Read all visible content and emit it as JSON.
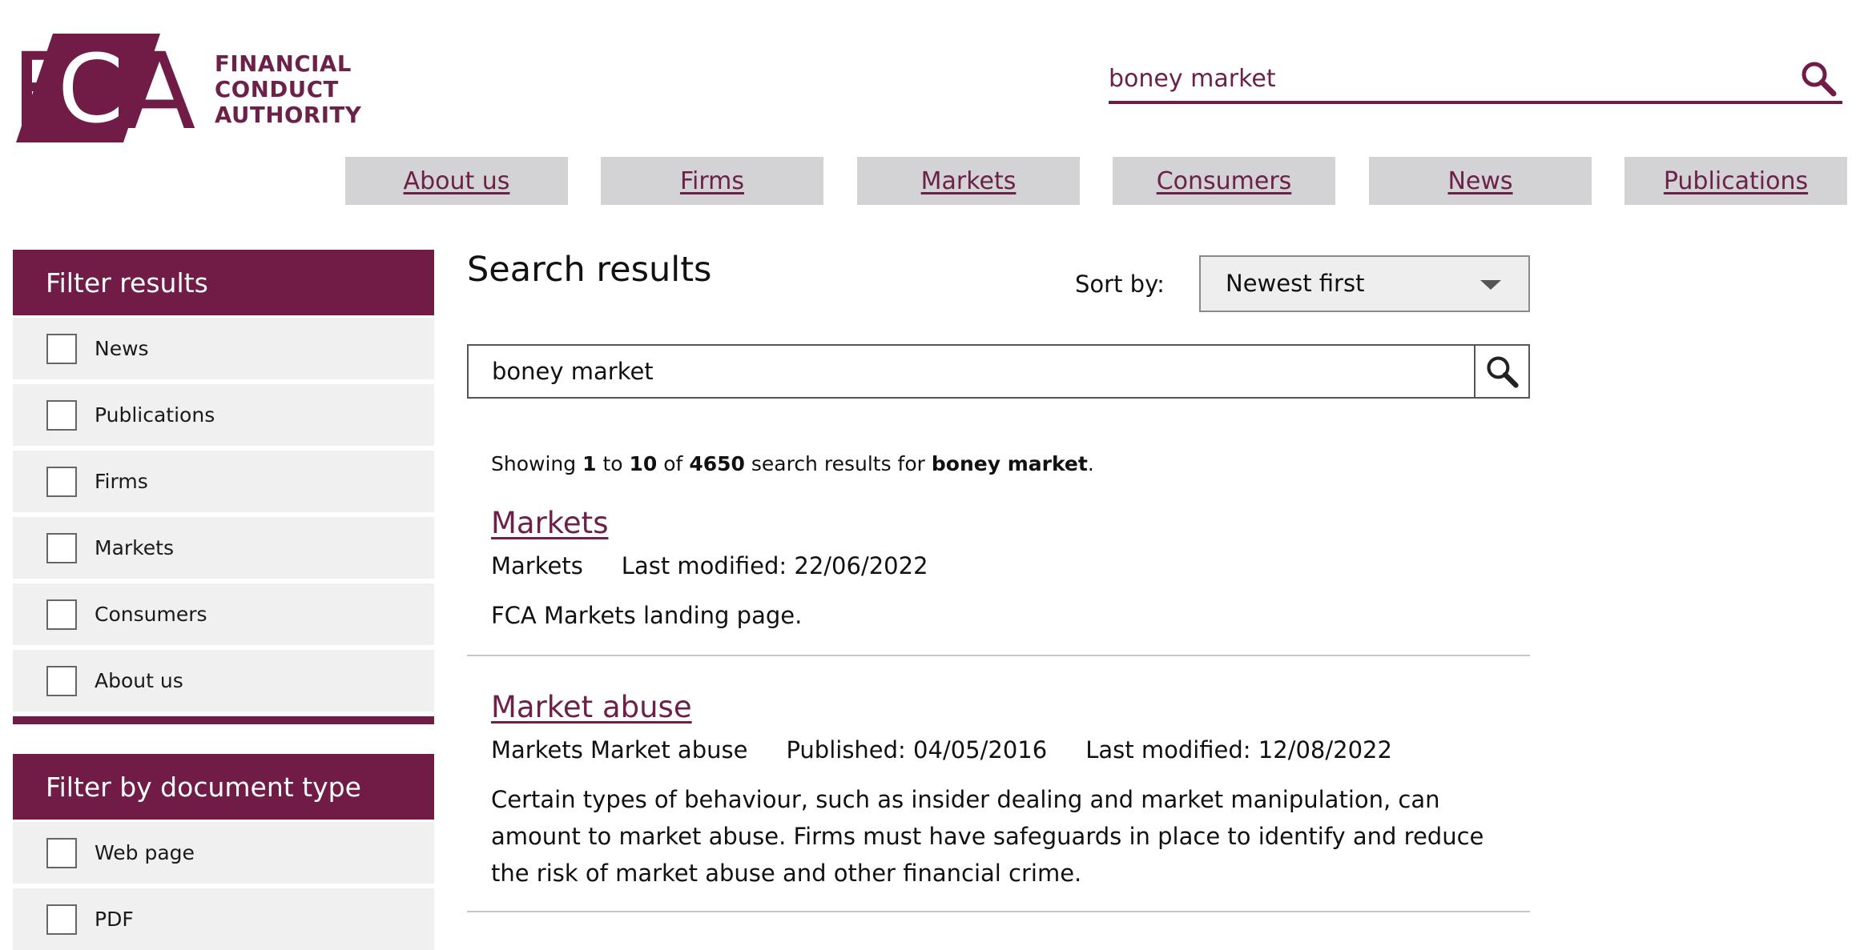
{
  "logo": {
    "lines": [
      "FINANCIAL",
      "CONDUCT",
      "AUTHORITY"
    ]
  },
  "header_search": {
    "value": "boney market"
  },
  "nav": [
    {
      "label": "About us"
    },
    {
      "label": "Firms"
    },
    {
      "label": "Markets"
    },
    {
      "label": "Consumers"
    },
    {
      "label": "News"
    },
    {
      "label": "Publications"
    }
  ],
  "filter_results": {
    "title": "Filter results",
    "items": [
      {
        "label": "News"
      },
      {
        "label": "Publications"
      },
      {
        "label": "Firms"
      },
      {
        "label": "Markets"
      },
      {
        "label": "Consumers"
      },
      {
        "label": "About us"
      }
    ]
  },
  "filter_doc_type": {
    "title": "Filter by document type",
    "items": [
      {
        "label": "Web page"
      },
      {
        "label": "PDF"
      }
    ]
  },
  "main": {
    "title": "Search results",
    "sort_label": "Sort by:",
    "sort_value": "Newest first",
    "search_value": "boney market",
    "showing": {
      "prefix": "Showing",
      "from": "1",
      "to_word": "to",
      "to": "10",
      "of_word": "of",
      "total": "4650",
      "mid": "search results for",
      "query": "boney market",
      "end": "."
    }
  },
  "results": [
    {
      "title": "Markets",
      "meta": [
        "Markets",
        "Last modified: 22/06/2022"
      ],
      "desc": "FCA Markets landing page."
    },
    {
      "title": "Market abuse",
      "meta": [
        "Markets Market abuse",
        "Published: 04/05/2016",
        "Last modified: 12/08/2022"
      ],
      "desc": "Certain types of behaviour, such as insider dealing and market manipulation, can amount to market abuse. Firms must have safeguards in place to identify and reduce the risk of market abuse and other financial crime."
    }
  ],
  "colors": {
    "brand": "#701c46",
    "nav_bg": "#d3d3d6",
    "panel_bg": "#f0f0f0"
  }
}
